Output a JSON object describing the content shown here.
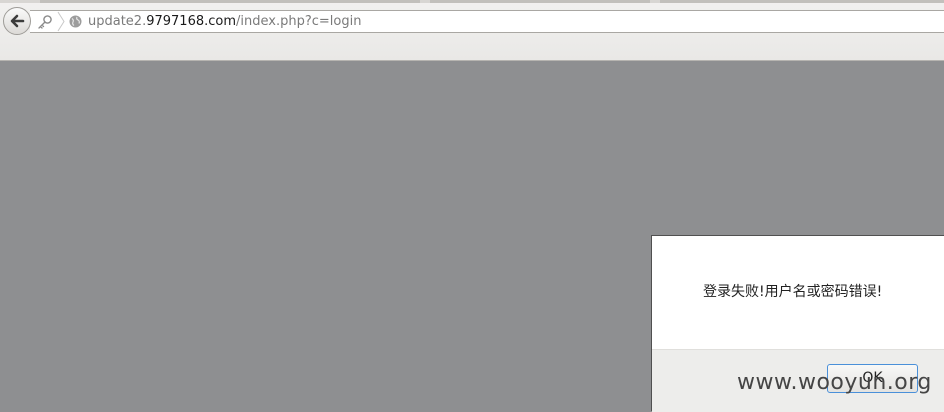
{
  "browser": {
    "url": {
      "prefix": "update2.",
      "domain": "9797168.com",
      "path": "/index.php?c=login"
    },
    "icons": {
      "back": "back-arrow-icon",
      "identity": "key-icon",
      "separator": "chevron-right-icon",
      "site": "globe-icon"
    }
  },
  "page": {
    "background": "#8e8f91"
  },
  "dialog": {
    "message": "登录失败!用户名或密码错误!",
    "ok_label": "OK",
    "ok_focus_color": "#4a90d9"
  },
  "watermark": {
    "text": "www.wooyun.org"
  }
}
